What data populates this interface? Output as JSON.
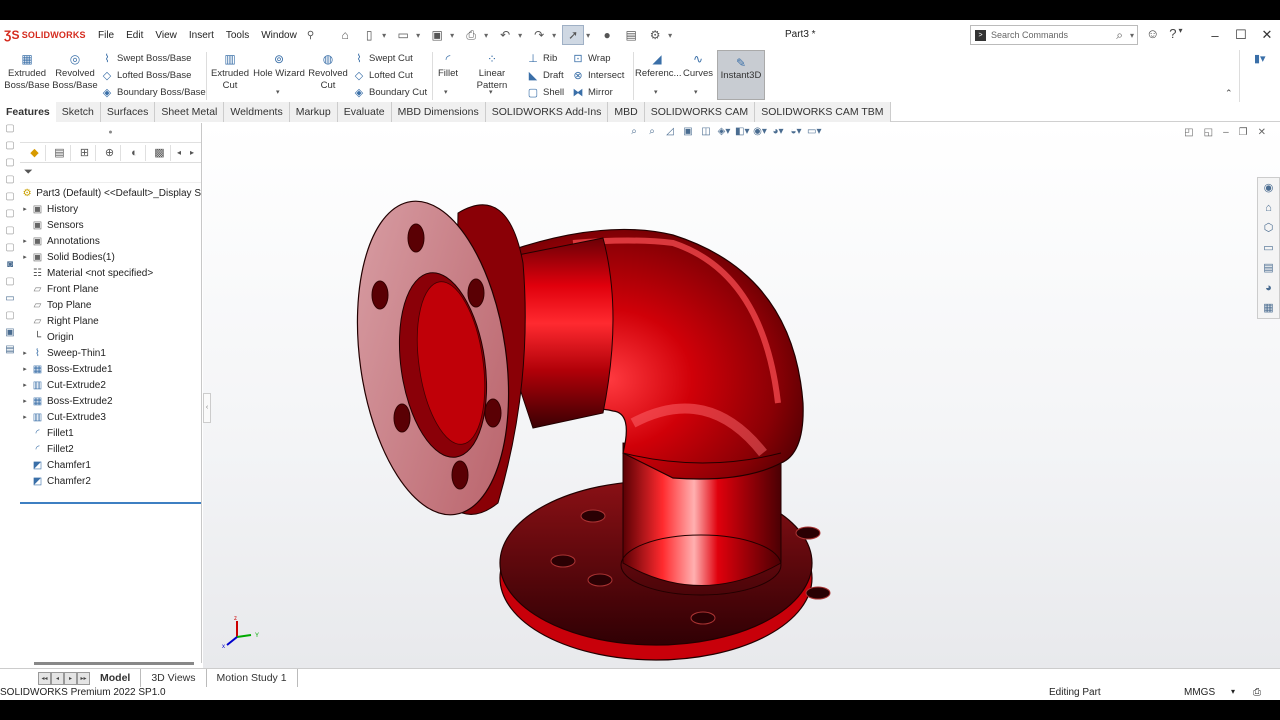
{
  "title_bar": {
    "brand": "SOLIDWORKS",
    "menu": [
      "File",
      "Edit",
      "View",
      "Insert",
      "Tools",
      "Window"
    ],
    "document_title": "Part3 *",
    "search_placeholder": "Search Commands"
  },
  "ribbon": {
    "extruded_boss": "Extruded Boss/Base",
    "revolved_boss": "Revolved Boss/Base",
    "swept_boss": "Swept Boss/Base",
    "lofted_boss": "Lofted Boss/Base",
    "boundary_boss": "Boundary Boss/Base",
    "extruded_cut": "Extruded Cut",
    "hole_wizard": "Hole Wizard",
    "revolved_cut": "Revolved Cut",
    "swept_cut": "Swept Cut",
    "lofted_cut": "Lofted Cut",
    "boundary_cut": "Boundary Cut",
    "fillet": "Fillet",
    "linear_pattern": "Linear Pattern",
    "rib": "Rib",
    "draft": "Draft",
    "shell": "Shell",
    "wrap": "Wrap",
    "intersect": "Intersect",
    "mirror": "Mirror",
    "reference": "Referenc...",
    "curves": "Curves",
    "instant3d": "Instant3D"
  },
  "tabs": [
    "Features",
    "Sketch",
    "Surfaces",
    "Sheet Metal",
    "Weldments",
    "Markup",
    "Evaluate",
    "MBD Dimensions",
    "SOLIDWORKS Add-Ins",
    "MBD",
    "SOLIDWORKS CAM",
    "SOLIDWORKS CAM TBM"
  ],
  "feature_tree": {
    "root": "Part3 (Default) <<Default>_Display S",
    "items": [
      "History",
      "Sensors",
      "Annotations",
      "Solid Bodies(1)",
      "Material <not specified>",
      "Front Plane",
      "Top Plane",
      "Right Plane",
      "Origin",
      "Sweep-Thin1",
      "Boss-Extrude1",
      "Cut-Extrude2",
      "Boss-Extrude2",
      "Cut-Extrude3",
      "Fillet1",
      "Fillet2",
      "Chamfer1",
      "Chamfer2"
    ]
  },
  "bottom_tabs": [
    "Model",
    "3D Views",
    "Motion Study 1"
  ],
  "status": {
    "product": "SOLIDWORKS Premium 2022 SP1.0",
    "mode": "Editing Part",
    "units": "MMGS"
  },
  "colors": {
    "brand_red": "#d52b1e",
    "part_red": "#c8000a",
    "accent_blue": "#3d7fc2"
  }
}
